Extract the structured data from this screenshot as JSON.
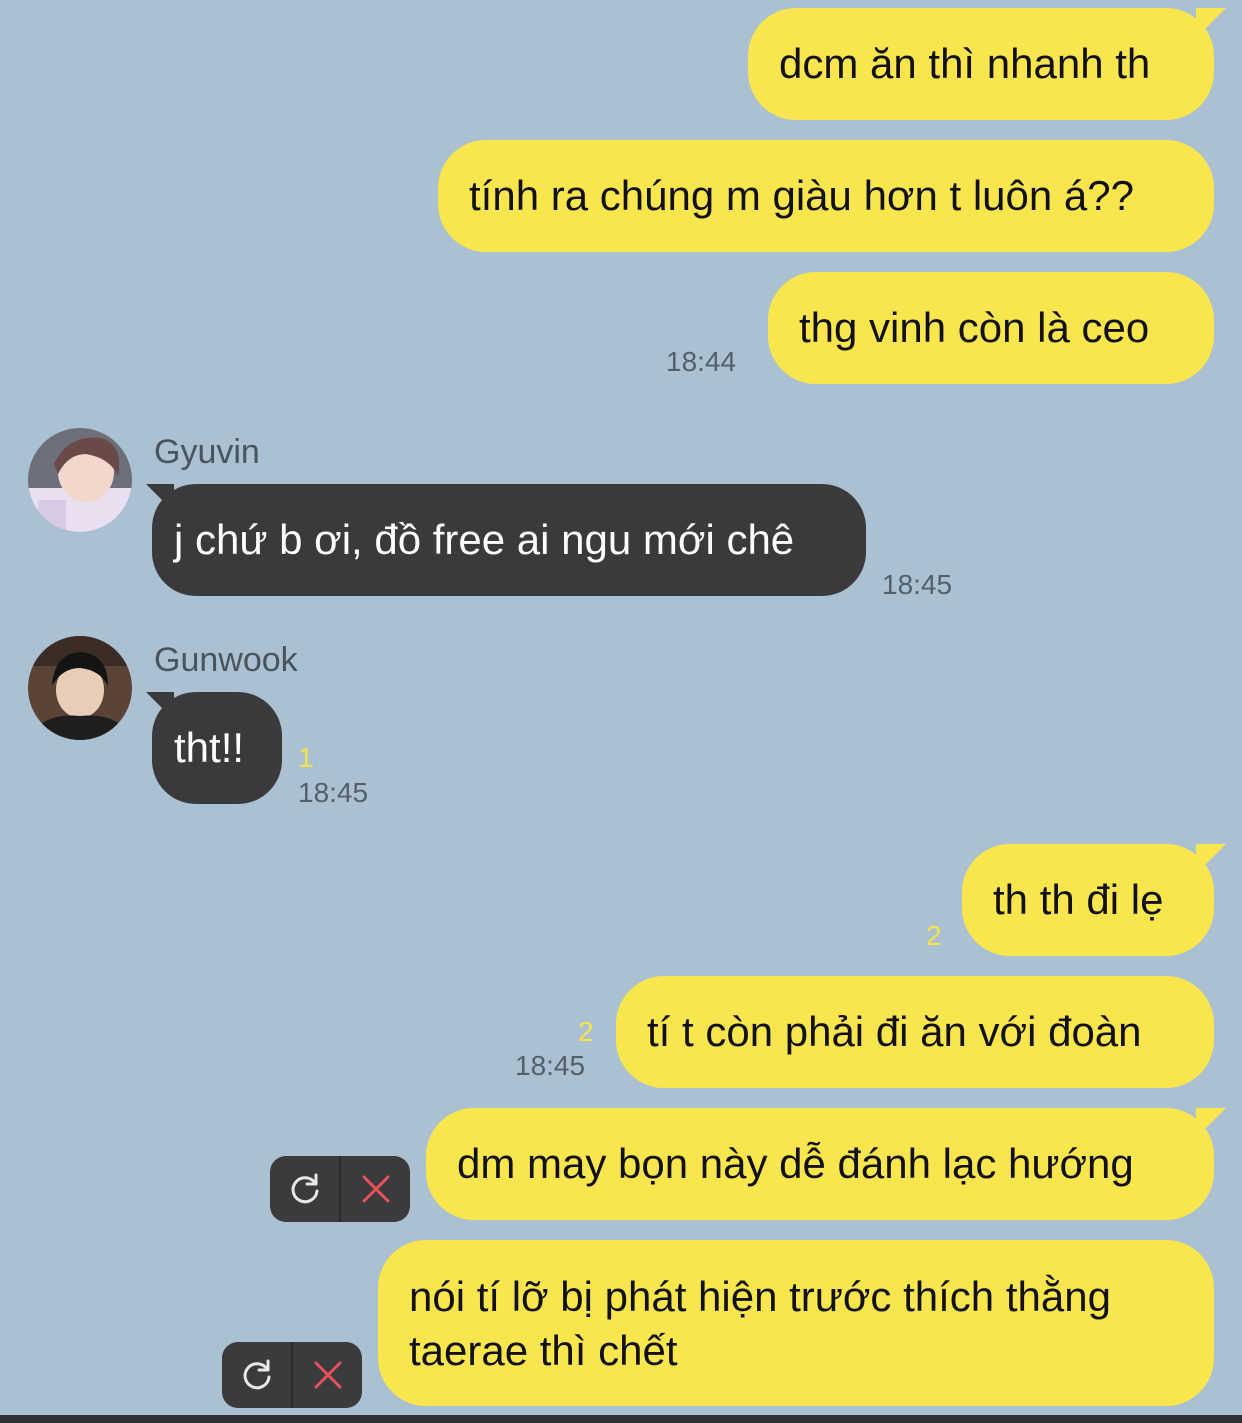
{
  "colors": {
    "background": "#abc1d1",
    "mine_bubble": "#f9e64e",
    "theirs_bubble": "#3a3a3c",
    "unread_count": "#f4e44a"
  },
  "messages": [
    {
      "id": "m1",
      "text": "dcm ăn thì nhanh th"
    },
    {
      "id": "m2",
      "text": "tính ra chúng m giàu hơn t luôn á??"
    },
    {
      "id": "m3",
      "text": "thg vinh còn là ceo",
      "time": "18:44"
    },
    {
      "id": "m4",
      "sender": "Gyuvin",
      "text": "j chứ b ơi, đồ free ai ngu mới chê",
      "time": "18:45",
      "avatar_icon": "avatar-gyuvin"
    },
    {
      "id": "m5",
      "sender": "Gunwook",
      "text": "tht!!",
      "unread": "1",
      "time": "18:45",
      "avatar_icon": "avatar-gunwook"
    },
    {
      "id": "m6",
      "text": "th th đi lẹ",
      "unread": "2"
    },
    {
      "id": "m7",
      "text": "tí t còn phải đi ăn với đoàn",
      "unread": "2",
      "time": "18:45"
    },
    {
      "id": "m8",
      "text": "dm may bọn này dễ đánh lạc hướng",
      "status": "failed",
      "actions": [
        "retry-icon",
        "close-icon"
      ]
    },
    {
      "id": "m9",
      "text": "nói tí lỡ bị phát hiện trước thích thằng taerae thì chết",
      "status": "failed",
      "actions": [
        "retry-icon",
        "close-icon"
      ]
    }
  ]
}
